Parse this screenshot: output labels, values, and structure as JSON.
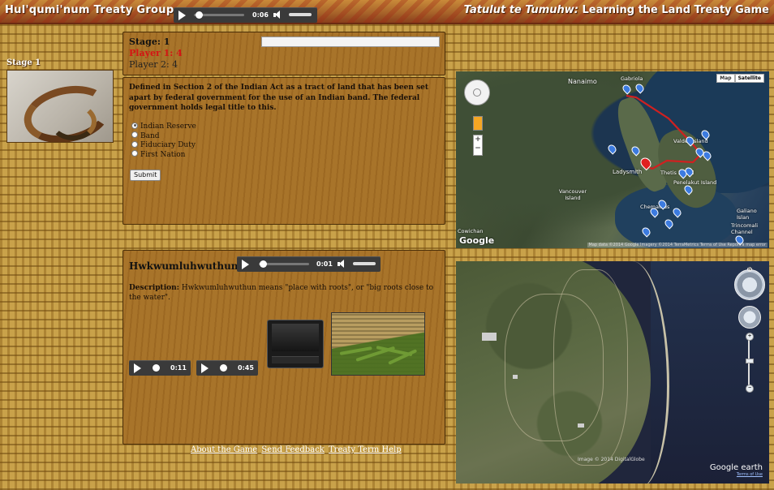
{
  "header": {
    "brand": "Hul'qumi'num Treaty Group",
    "title_italic": "Tatulut te Tumuhw:",
    "title_rest": " Learning the Land Treaty Game",
    "audio": {
      "time": "0:06"
    }
  },
  "sidebar": {
    "stage_label": "Stage 1",
    "image_icon": "stage-photo"
  },
  "status": {
    "stage": "Stage: 1",
    "player1": "Player 1: 4",
    "player2": "Player 2: 4",
    "player1_color": "#d41414"
  },
  "question": {
    "text": "Defined in Section 2 of the Indian Act as a tract of land that has been set apart by federal government for the use of an Indian band. The federal government holds legal title to this.",
    "options": [
      "Indian Reserve",
      "Band",
      "Fiduciary Duty",
      "First Nation"
    ],
    "selected": 0,
    "submit_label": "Submit"
  },
  "place": {
    "name": "Hwkwumluhwuthun",
    "audio_time": "0:01",
    "desc_label": "Description:",
    "desc_text": " Hwkwumluhwuthun means \"place with roots\", or \"big roots close to the water\".",
    "clip1_time": "0:11",
    "clip2_time": "0:45"
  },
  "footer": {
    "links": [
      "About the Game",
      "Send Feedback",
      "Treaty Term Help"
    ]
  },
  "map": {
    "type_map": "Map",
    "type_satellite": "Satellite",
    "labels": [
      "Nanaimo",
      "Gabriola",
      "Valdes Island",
      "Ladysmith",
      "Thetis Island",
      "Penelakut Island",
      "Vancouver Island",
      "Chemainus",
      "Galiano Islan",
      "Trincomali Channel",
      "Cowichan"
    ],
    "logo": "Google",
    "attribution": "Map data ©2014 Google Imagery ©2014 TerraMetrics   Terms of Use   Report a map error"
  },
  "earth": {
    "credit": "Image © 2014 DigitalGlobe",
    "logo": "Google earth",
    "terms": "Terms of Use"
  }
}
